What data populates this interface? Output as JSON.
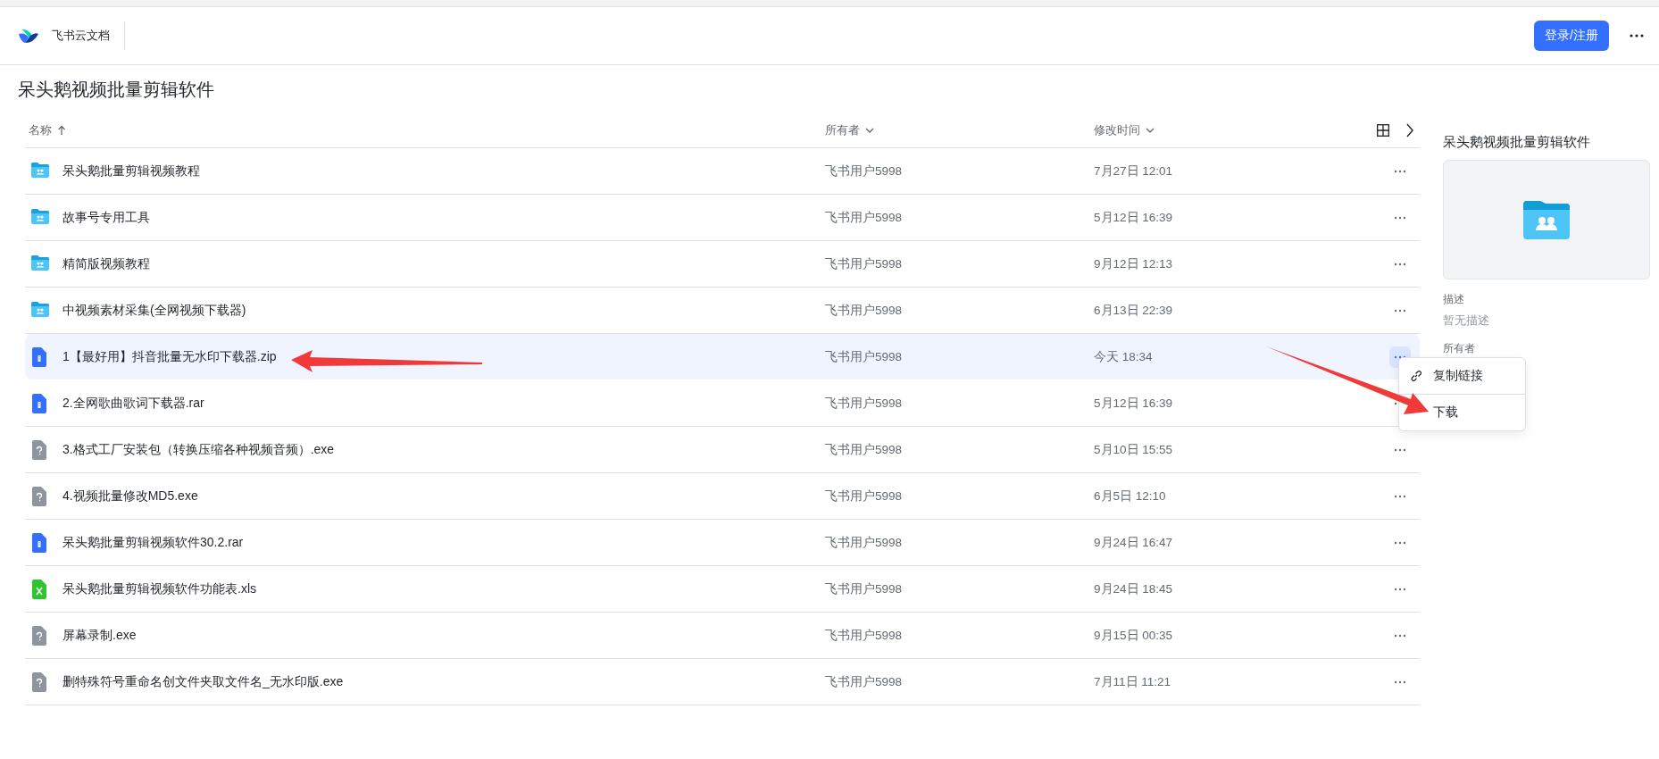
{
  "header": {
    "app_name": "飞书云文档",
    "login_button": "登录/注册"
  },
  "page_title": "呆头鹅视频批量剪辑软件",
  "table": {
    "columns": [
      {
        "label": "名称",
        "sorted": true,
        "dropdown": false
      },
      {
        "label": "所有者",
        "sorted": false,
        "dropdown": true
      },
      {
        "label": "修改时间",
        "sorted": false,
        "dropdown": true
      }
    ],
    "rows": [
      {
        "kind": "folder",
        "name": "呆头鹅批量剪辑视频教程",
        "owner": "飞书用户5998",
        "modified": "7月27日 12:01",
        "selected": false
      },
      {
        "kind": "folder",
        "name": "故事号专用工具",
        "owner": "飞书用户5998",
        "modified": "5月12日 16:39",
        "selected": false
      },
      {
        "kind": "folder",
        "name": "精简版视频教程",
        "owner": "飞书用户5998",
        "modified": "9月12日 12:13",
        "selected": false
      },
      {
        "kind": "folder",
        "name": "中视频素材采集(全网视频下载器)",
        "owner": "飞书用户5998",
        "modified": "6月13日 22:39",
        "selected": false
      },
      {
        "kind": "archive",
        "name": "1【最好用】抖音批量无水印下载器.zip",
        "owner": "飞书用户5998",
        "modified": "今天 18:34",
        "selected": true
      },
      {
        "kind": "archive",
        "name": "2.全网歌曲歌词下载器.rar",
        "owner": "飞书用户5998",
        "modified": "5月12日 16:39",
        "selected": false
      },
      {
        "kind": "unknown",
        "name": "3.格式工厂安装包（转换压缩各种视频音频）.exe",
        "owner": "飞书用户5998",
        "modified": "5月10日 15:55",
        "selected": false
      },
      {
        "kind": "unknown",
        "name": "4.视频批量修改MD5.exe",
        "owner": "飞书用户5998",
        "modified": "6月5日 12:10",
        "selected": false
      },
      {
        "kind": "archive",
        "name": "呆头鹅批量剪辑视频软件30.2.rar",
        "owner": "飞书用户5998",
        "modified": "9月24日 16:47",
        "selected": false
      },
      {
        "kind": "sheet",
        "name": "呆头鹅批量剪辑视频软件功能表.xls",
        "owner": "飞书用户5998",
        "modified": "9月24日 18:45",
        "selected": false
      },
      {
        "kind": "unknown",
        "name": "屏幕录制.exe",
        "owner": "飞书用户5998",
        "modified": "9月15日 00:35",
        "selected": false
      },
      {
        "kind": "unknown",
        "name": "删特殊符号重命名创文件夹取文件名_无水印版.exe",
        "owner": "飞书用户5998",
        "modified": "7月11日 11:21",
        "selected": false
      }
    ]
  },
  "details": {
    "title": "呆头鹅视频批量剪辑软件",
    "description_label": "描述",
    "description": "暂无描述",
    "owner_label": "所有者"
  },
  "context_menu": [
    {
      "kind": "link",
      "label": "复制链接"
    },
    {
      "kind": "plain",
      "label": "下载"
    }
  ]
}
